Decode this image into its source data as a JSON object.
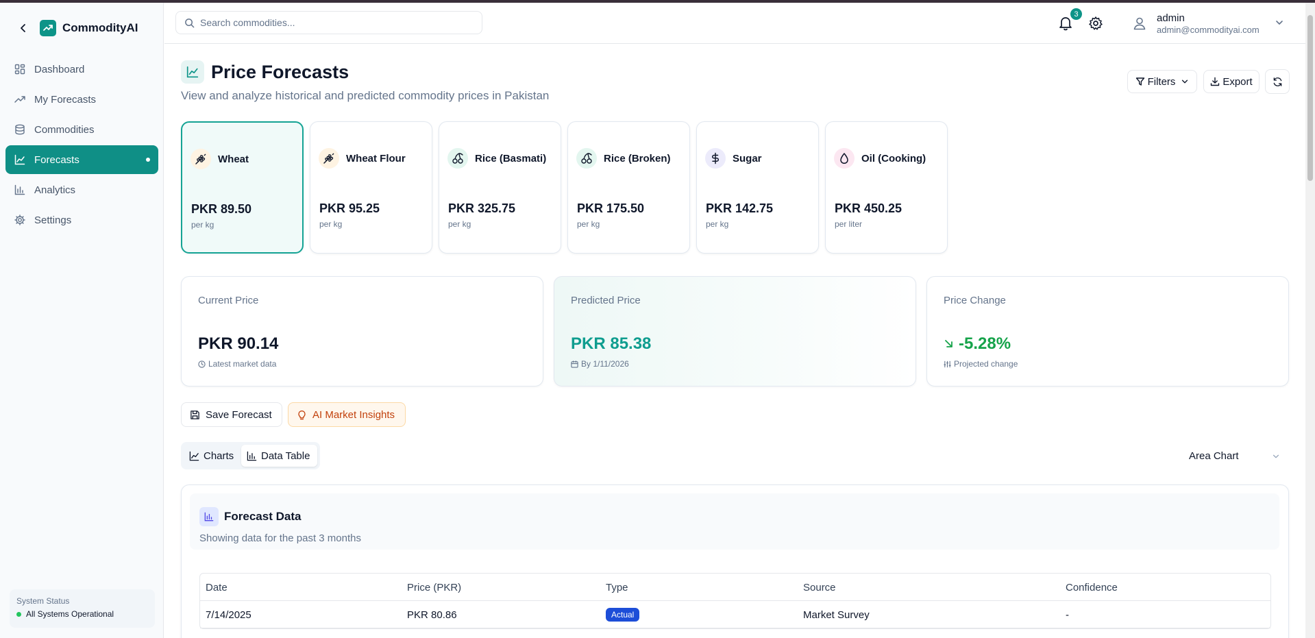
{
  "app": {
    "name": "CommodityAI"
  },
  "nav": [
    {
      "label": "Dashboard",
      "icon": "grid-icon"
    },
    {
      "label": "My Forecasts",
      "icon": "trend-icon"
    },
    {
      "label": "Commodities",
      "icon": "database-icon"
    },
    {
      "label": "Forecasts",
      "icon": "line-chart-icon",
      "active": true
    },
    {
      "label": "Analytics",
      "icon": "bar-chart-icon"
    },
    {
      "label": "Settings",
      "icon": "gear-icon"
    }
  ],
  "system_status": {
    "label": "System Status",
    "value": "All Systems Operational"
  },
  "header": {
    "search_placeholder": "Search commodities...",
    "notifications": "3",
    "user_name": "admin",
    "user_email": "admin@commodityai.com"
  },
  "page": {
    "title": "Price Forecasts",
    "subtitle": "View and analyze historical and predicted commodity prices in Pakistan",
    "filters_label": "Filters",
    "export_label": "Export"
  },
  "commodities": [
    {
      "name": "Wheat",
      "price": "PKR 89.50",
      "unit": "per kg",
      "icon": "wheat-icon",
      "color": "#f59e0b",
      "bg": "#fef3e2"
    },
    {
      "name": "Wheat Flour",
      "price": "PKR 95.25",
      "unit": "per kg",
      "icon": "wheat-icon",
      "color": "#f59e0b",
      "bg": "#fef3e2"
    },
    {
      "name": "Rice (Basmati)",
      "price": "PKR 325.75",
      "unit": "per kg",
      "icon": "cherries-icon",
      "color": "#10b981",
      "bg": "#e3f6ef"
    },
    {
      "name": "Rice (Broken)",
      "price": "PKR 175.50",
      "unit": "per kg",
      "icon": "cherries-icon",
      "color": "#10b981",
      "bg": "#e3f6ef"
    },
    {
      "name": "Sugar",
      "price": "PKR 142.75",
      "unit": "per kg",
      "icon": "dollar-icon",
      "color": "#6366f1",
      "bg": "#ecebfb"
    },
    {
      "name": "Oil (Cooking)",
      "price": "PKR 450.25",
      "unit": "per liter",
      "icon": "droplet-icon",
      "color": "#ec4899",
      "bg": "#fce7f1"
    }
  ],
  "stats": {
    "current": {
      "label": "Current Price",
      "value": "PKR 90.14",
      "sub": "Latest market data"
    },
    "predicted": {
      "label": "Predicted Price",
      "value": "PKR 85.38",
      "sub": "By 1/11/2026"
    },
    "change": {
      "label": "Price Change",
      "value": "-5.28%",
      "sub": "Projected change"
    }
  },
  "actions": {
    "save": "Save Forecast",
    "insights": "AI Market Insights"
  },
  "tabs": {
    "charts": "Charts",
    "table": "Data Table"
  },
  "chart_type": "Area Chart",
  "panel": {
    "title": "Forecast Data",
    "subtitle": "Showing data for the past 3 months"
  },
  "table": {
    "headers": [
      "Date",
      "Price (PKR)",
      "Type",
      "Source",
      "Confidence"
    ],
    "rows": [
      [
        "7/14/2025",
        "PKR 80.86",
        "Actual",
        "Market Survey",
        "-"
      ]
    ]
  },
  "colors": {
    "accent": "#0d9488",
    "positive": "#16a34a",
    "predicted": "#0f9d8f",
    "actual_badge": "#1d4ed8"
  }
}
